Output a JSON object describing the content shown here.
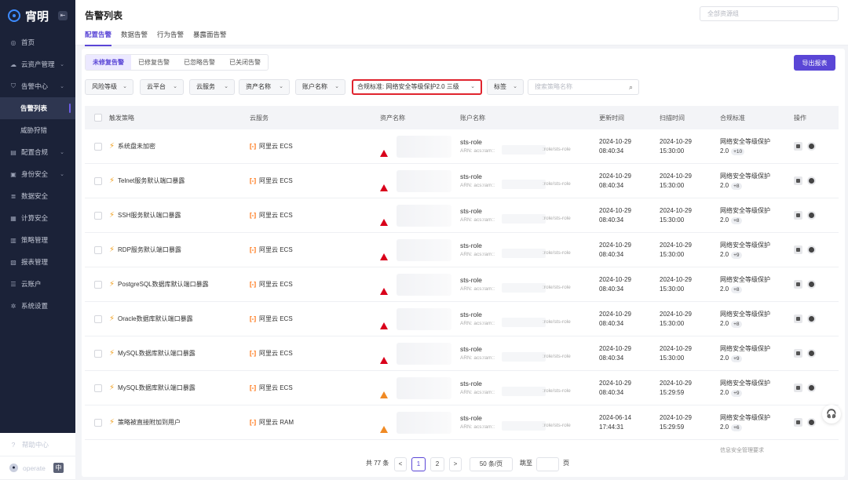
{
  "sidebar": {
    "brand": "宵明",
    "collapse_icon": "collapse-icon",
    "items": [
      {
        "label": "首页",
        "icon": "home-icon",
        "has_chevron": false
      },
      {
        "label": "云资产管理",
        "icon": "cloud-icon",
        "has_chevron": true
      },
      {
        "label": "告警中心",
        "icon": "shield-icon",
        "has_chevron": true
      },
      {
        "label": "告警列表",
        "sub": true,
        "active": true
      },
      {
        "label": "威胁狩猎",
        "sub": true
      },
      {
        "label": "配置合规",
        "icon": "chart-icon",
        "has_chevron": true
      },
      {
        "label": "身份安全",
        "icon": "id-icon",
        "has_chevron": true
      },
      {
        "label": "数据安全",
        "icon": "database-icon",
        "has_chevron": false
      },
      {
        "label": "计算安全",
        "icon": "compute-icon",
        "has_chevron": false
      },
      {
        "label": "策略管理",
        "icon": "policy-icon",
        "has_chevron": false
      },
      {
        "label": "报表管理",
        "icon": "report-icon",
        "has_chevron": false
      },
      {
        "label": "云账户",
        "icon": "account-icon",
        "has_chevron": false
      },
      {
        "label": "系统设置",
        "icon": "gear-icon",
        "has_chevron": false
      }
    ],
    "help": "帮助中心",
    "user": "operate",
    "lang": "中"
  },
  "header": {
    "title": "告警列表",
    "tabs": [
      "配置告警",
      "数据告警",
      "行为告警",
      "暴露面告警"
    ],
    "group_placeholder": "全部资源组"
  },
  "subtabs": [
    "未修复告警",
    "已修复告警",
    "已忽略告警",
    "已关闭告警"
  ],
  "export_label": "导出报表",
  "filters": {
    "risk": "风险等级",
    "platform": "云平台",
    "service": "云服务",
    "asset": "资产名称",
    "account": "账户名称",
    "compliance": "合规标准: 网络安全等级保护2.0 三级",
    "tag": "标签",
    "search_placeholder": "搜索策略名称"
  },
  "columns": [
    "触发策略",
    "云服务",
    "资产名称",
    "账户名称",
    "更新时间",
    "扫描时间",
    "合规标准",
    "操作"
  ],
  "rows": [
    {
      "policy": "系统盘未加密",
      "service": "阿里云 ECS",
      "severity": "high",
      "role": "sts-role",
      "arn": "ARN: acs:ram::",
      "arn_tail": ":role/sts-role",
      "upd_d": "2024-10-29",
      "upd_t": "08:40:34",
      "scan_d": "2024-10-29",
      "scan_t": "15:30:00",
      "std1": "网络安全等级保护",
      "std2": "2.0",
      "more": "+10"
    },
    {
      "policy": "Telnet服务默认端口暴露",
      "service": "阿里云 ECS",
      "severity": "high",
      "role": "sts-role",
      "arn": "ARN: acs:ram::",
      "arn_tail": ":role/sts-role",
      "upd_d": "2024-10-29",
      "upd_t": "08:40:34",
      "scan_d": "2024-10-29",
      "scan_t": "15:30:00",
      "std1": "网络安全等级保护",
      "std2": "2.0",
      "more": "+8"
    },
    {
      "policy": "SSH服务默认端口暴露",
      "service": "阿里云 ECS",
      "severity": "high",
      "role": "sts-role",
      "arn": "ARN: acs:ram::",
      "arn_tail": ":role/sts-role",
      "upd_d": "2024-10-29",
      "upd_t": "08:40:34",
      "scan_d": "2024-10-29",
      "scan_t": "15:30:00",
      "std1": "网络安全等级保护",
      "std2": "2.0",
      "more": "+8"
    },
    {
      "policy": "RDP服务默认端口暴露",
      "service": "阿里云 ECS",
      "severity": "high",
      "role": "sts-role",
      "arn": "ARN: acs:ram::",
      "arn_tail": ":role/sts-role",
      "upd_d": "2024-10-29",
      "upd_t": "08:40:34",
      "scan_d": "2024-10-29",
      "scan_t": "15:30:00",
      "std1": "网络安全等级保护",
      "std2": "2.0",
      "more": "+9"
    },
    {
      "policy": "PostgreSQL数据库默认端口暴露",
      "service": "阿里云 ECS",
      "severity": "high",
      "role": "sts-role",
      "arn": "ARN: acs:ram::",
      "arn_tail": ":role/sts-role",
      "upd_d": "2024-10-29",
      "upd_t": "08:40:34",
      "scan_d": "2024-10-29",
      "scan_t": "15:30:00",
      "std1": "网络安全等级保护",
      "std2": "2.0",
      "more": "+8"
    },
    {
      "policy": "Oracle数据库默认端口暴露",
      "service": "阿里云 ECS",
      "severity": "high",
      "role": "sts-role",
      "arn": "ARN: acs:ram::",
      "arn_tail": ":role/sts-role",
      "upd_d": "2024-10-29",
      "upd_t": "08:40:34",
      "scan_d": "2024-10-29",
      "scan_t": "15:30:00",
      "std1": "网络安全等级保护",
      "std2": "2.0",
      "more": "+8"
    },
    {
      "policy": "MySQL数据库默认端口暴露",
      "service": "阿里云 ECS",
      "severity": "high",
      "role": "sts-role",
      "arn": "ARN: acs:ram::",
      "arn_tail": ":role/sts-role",
      "upd_d": "2024-10-29",
      "upd_t": "08:40:34",
      "scan_d": "2024-10-29",
      "scan_t": "15:30:00",
      "std1": "网络安全等级保护",
      "std2": "2.0",
      "more": "+9"
    },
    {
      "policy": "MySQL数据库默认端口暴露",
      "service": "阿里云 ECS",
      "severity": "medium",
      "role": "sts-role",
      "arn": "ARN: acs:ram::",
      "arn_tail": ":role/sts-role",
      "upd_d": "2024-10-29",
      "upd_t": "08:40:34",
      "scan_d": "2024-10-29",
      "scan_t": "15:29:59",
      "std1": "网络安全等级保护",
      "std2": "2.0",
      "more": "+9"
    },
    {
      "policy": "策略被直接附加到用户",
      "service": "阿里云 RAM",
      "severity": "medium",
      "role": "sts-role",
      "arn": "ARN: acs:ram::",
      "arn_tail": ":role/sts-role",
      "upd_d": "2024-06-14",
      "upd_t": "17:44:31",
      "scan_d": "2024-10-29",
      "scan_t": "15:29:59",
      "std1": "网络安全等级保护",
      "std2": "2.0",
      "more": "+6"
    }
  ],
  "next_row_peek": "信息安全管理要求",
  "pager": {
    "total": "共 77 条",
    "pages": [
      "1",
      "2"
    ],
    "prev": "<",
    "next": ">",
    "page_size": "50 条/页",
    "goto_label": "跳至",
    "page_unit": "页"
  },
  "colors": {
    "accent": "#5a46d6",
    "sidebar_bg": "#1b2238",
    "high": "#d9001b",
    "medium": "#f08a24",
    "highlight_border": "#e0242e"
  }
}
